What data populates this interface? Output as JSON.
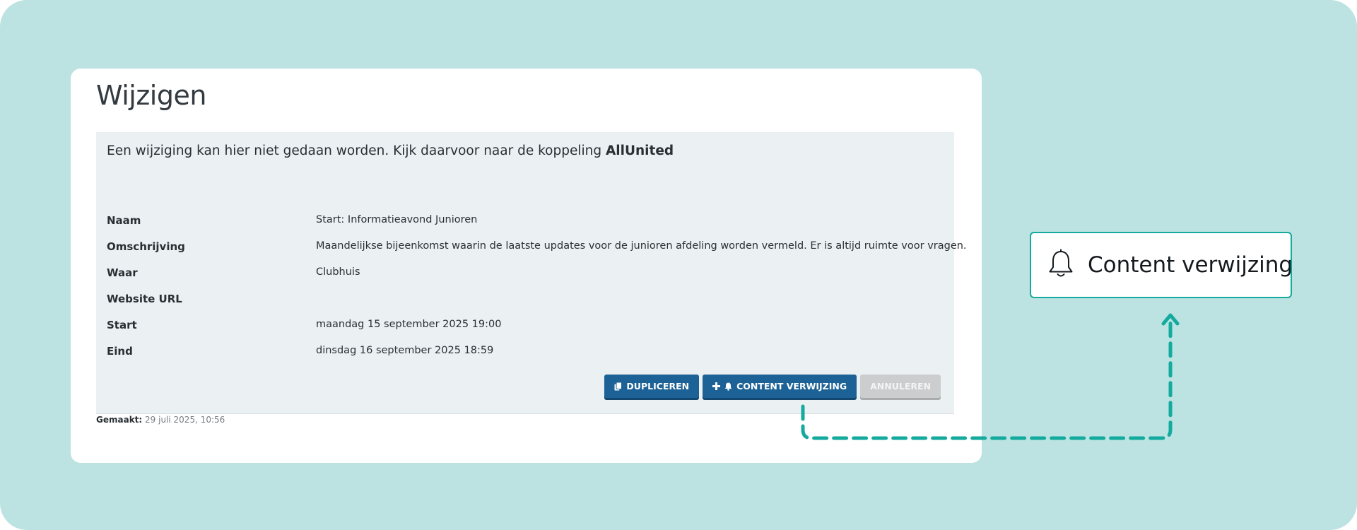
{
  "page": {
    "title": "Wijzigen"
  },
  "notice": {
    "text": "Een wijziging kan hier niet gedaan worden. Kijk daarvoor naar de koppeling ",
    "link_text": "AllUnited"
  },
  "fields": [
    {
      "label": "Naam",
      "value": "Start: Informatieavond Junioren"
    },
    {
      "label": "Omschrijving",
      "value": "Maandelijkse bijeenkomst waarin de laatste updates voor de junioren afdeling worden vermeld. Er is altijd ruimte voor vragen."
    },
    {
      "label": "Waar",
      "value": "Clubhuis"
    },
    {
      "label": "Website URL",
      "value": ""
    },
    {
      "label": "Start",
      "value": "maandag 15 september 2025 19:00"
    },
    {
      "label": "Eind",
      "value": "dinsdag 16 september 2025 18:59"
    }
  ],
  "actions": {
    "duplicate_label": "DUPLICEREN",
    "content_ref_label": "CONTENT VERWIJZING",
    "cancel_label": "ANNULEREN"
  },
  "meta": {
    "created_label": "Gemaakt:",
    "created_value": "29 juli 2025, 10:56"
  },
  "callout": {
    "label": "Content verwijzing",
    "icon": "bell-icon"
  },
  "colors": {
    "background": "#bce3e2",
    "primary_button": "#1d6296",
    "disabled_button": "#cbcdcf",
    "accent": "#15aa9e",
    "panel": "#ebf0f3"
  }
}
